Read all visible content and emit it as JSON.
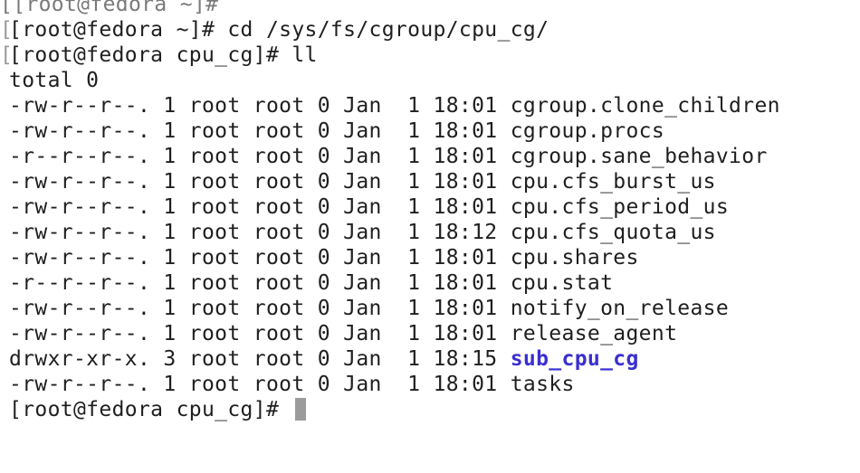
{
  "terminal": {
    "partial_top_line": "[[root@fedora ~]#",
    "commands": [
      {
        "bracket": "[",
        "prompt": "[root@fedora ~]# ",
        "command": "cd /sys/fs/cgroup/cpu_cg/"
      },
      {
        "bracket": "[",
        "prompt": "[root@fedora cpu_cg]# ",
        "command": "ll"
      }
    ],
    "total_line": "total 0",
    "listing": [
      {
        "perms": "-rw-r--r--.",
        "links": "1",
        "owner": "root",
        "group": "root",
        "size": "0",
        "month": "Jan",
        "day": " 1",
        "time": "18:01",
        "name": "cgroup.clone_children",
        "is_dir": false
      },
      {
        "perms": "-rw-r--r--.",
        "links": "1",
        "owner": "root",
        "group": "root",
        "size": "0",
        "month": "Jan",
        "day": " 1",
        "time": "18:01",
        "name": "cgroup.procs",
        "is_dir": false
      },
      {
        "perms": "-r--r--r--.",
        "links": "1",
        "owner": "root",
        "group": "root",
        "size": "0",
        "month": "Jan",
        "day": " 1",
        "time": "18:01",
        "name": "cgroup.sane_behavior",
        "is_dir": false
      },
      {
        "perms": "-rw-r--r--.",
        "links": "1",
        "owner": "root",
        "group": "root",
        "size": "0",
        "month": "Jan",
        "day": " 1",
        "time": "18:01",
        "name": "cpu.cfs_burst_us",
        "is_dir": false
      },
      {
        "perms": "-rw-r--r--.",
        "links": "1",
        "owner": "root",
        "group": "root",
        "size": "0",
        "month": "Jan",
        "day": " 1",
        "time": "18:01",
        "name": "cpu.cfs_period_us",
        "is_dir": false
      },
      {
        "perms": "-rw-r--r--.",
        "links": "1",
        "owner": "root",
        "group": "root",
        "size": "0",
        "month": "Jan",
        "day": " 1",
        "time": "18:12",
        "name": "cpu.cfs_quota_us",
        "is_dir": false
      },
      {
        "perms": "-rw-r--r--.",
        "links": "1",
        "owner": "root",
        "group": "root",
        "size": "0",
        "month": "Jan",
        "day": " 1",
        "time": "18:01",
        "name": "cpu.shares",
        "is_dir": false
      },
      {
        "perms": "-r--r--r--.",
        "links": "1",
        "owner": "root",
        "group": "root",
        "size": "0",
        "month": "Jan",
        "day": " 1",
        "time": "18:01",
        "name": "cpu.stat",
        "is_dir": false
      },
      {
        "perms": "-rw-r--r--.",
        "links": "1",
        "owner": "root",
        "group": "root",
        "size": "0",
        "month": "Jan",
        "day": " 1",
        "time": "18:01",
        "name": "notify_on_release",
        "is_dir": false
      },
      {
        "perms": "-rw-r--r--.",
        "links": "1",
        "owner": "root",
        "group": "root",
        "size": "0",
        "month": "Jan",
        "day": " 1",
        "time": "18:01",
        "name": "release_agent",
        "is_dir": false
      },
      {
        "perms": "drwxr-xr-x.",
        "links": "3",
        "owner": "root",
        "group": "root",
        "size": "0",
        "month": "Jan",
        "day": " 1",
        "time": "18:15",
        "name": "sub_cpu_cg",
        "is_dir": true
      },
      {
        "perms": "-rw-r--r--.",
        "links": "1",
        "owner": "root",
        "group": "root",
        "size": "0",
        "month": "Jan",
        "day": " 1",
        "time": "18:01",
        "name": "tasks",
        "is_dir": false
      }
    ],
    "final_prompt": "[root@fedora cpu_cg]# ",
    "colors": {
      "text": "#1f1f1f",
      "directory": "#3a2fd0",
      "cursor": "#9b9b9b",
      "background": "#ffffff"
    }
  }
}
